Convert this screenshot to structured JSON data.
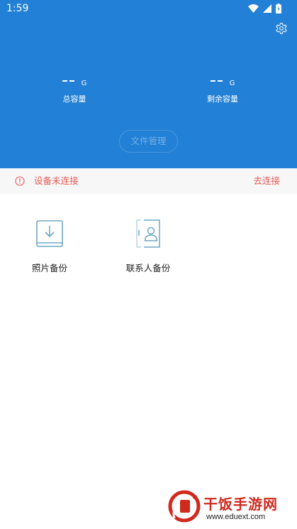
{
  "status_bar": {
    "time": "1:59",
    "icons": [
      "wifi-icon",
      "signal-icon",
      "battery-icon"
    ]
  },
  "header": {
    "settings_icon": "gear-icon",
    "total_capacity": {
      "value": "--",
      "unit": "G",
      "label": "总容量"
    },
    "remaining_capacity": {
      "value": "--",
      "unit": "G",
      "label": "剩余容量"
    },
    "file_manage_label": "文件管理"
  },
  "alert": {
    "icon": "info-circle-icon",
    "message": "设备未连接",
    "action_label": "去连接"
  },
  "features": [
    {
      "label": "照片备份",
      "icon": "download-icon"
    },
    {
      "label": "联系人备份",
      "icon": "contacts-icon"
    }
  ],
  "watermark": {
    "name": "干饭手游网",
    "url": "www.eduext.com"
  },
  "colors": {
    "header_bg": "#2280d6",
    "alert_text": "#e55a54",
    "alert_bg": "#f7f7f7",
    "icon_accent": "#6fa8c4",
    "watermark_red": "#d02a1f"
  }
}
